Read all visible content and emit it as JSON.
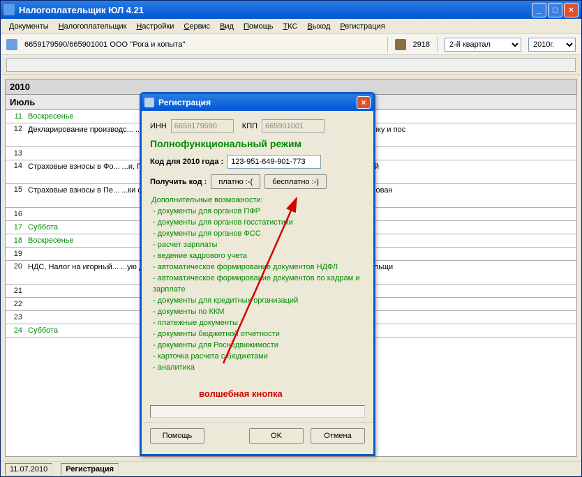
{
  "window": {
    "title": "Налогоплательщик ЮЛ 4.21"
  },
  "menu": {
    "items": [
      {
        "ul": "Д",
        "rest": "окументы"
      },
      {
        "ul": "Н",
        "rest": "алогоплательщик"
      },
      {
        "ul": "Н",
        "rest": "астройки"
      },
      {
        "ul": "С",
        "rest": "ервис"
      },
      {
        "ul": "В",
        "rest": "ид"
      },
      {
        "ul": "П",
        "rest": "омощь"
      },
      {
        "ul": "Т",
        "rest": "КС"
      },
      {
        "ul": "В",
        "rest": "ыход"
      },
      {
        "ul": "Р",
        "rest": "егистрация"
      }
    ]
  },
  "toolbar": {
    "org": "6659179590/665901001 ООО ''Рога и копыта''",
    "code": "2918",
    "quarter": "2-й квартал",
    "year": "2010г."
  },
  "calendar": {
    "year": "2010",
    "month": "Июль",
    "rows": [
      {
        "day": "11",
        "desc": "Воскресенье",
        "green": true
      },
      {
        "day": "12",
        "desc": "Декларирование производс... ...и спиртосодержащей продукции, Организаци производство, закупку и пос",
        "tall": true
      },
      {
        "day": "13",
        "desc": ""
      },
      {
        "day": "14",
        "desc": "Страховые взносы в Фо... ...и, Плательщики страховых взносов на обяза на прибыль организаций",
        "tall": true
      },
      {
        "day": "15",
        "desc": "Страховые взносы в Пе... ...ки страховых взносов на обязательное пенс Фонд социального страхован",
        "tall": true
      },
      {
        "day": "16",
        "desc": ""
      },
      {
        "day": "17",
        "desc": "Суббота",
        "green": true
      },
      {
        "day": "18",
        "desc": "Воскресенье",
        "green": true
      },
      {
        "day": "19",
        "desc": ""
      },
      {
        "day": "20",
        "desc": "НДС, Налог на игорный... ...ую декларацию и, Сбор за пользование объе ресурсов, Налогоплательщи",
        "tall": true
      },
      {
        "day": "21",
        "desc": ""
      },
      {
        "day": "22",
        "desc": ""
      },
      {
        "day": "23",
        "desc": ""
      },
      {
        "day": "24",
        "desc": "Суббота",
        "green": true
      }
    ]
  },
  "statusbar": {
    "date": "11.07.2010",
    "mode": "Регистрация"
  },
  "dialog": {
    "title": "Регистрация",
    "inn_label": "ИНН",
    "inn_value": "6659179590",
    "kpp_label": "КПП",
    "kpp_value": "665901001",
    "mode_title": "Полнофункциональный режим",
    "code_label": "Код для 2010 года :",
    "code_value": "123-951-649-901-773",
    "get_code_label": "Получить код :",
    "pay_btn": "платно  :-(",
    "free_btn": "бесплатно  :-)",
    "features_header": "Дополнительные возможности:",
    "features": [
      "- документы для органов ПФР",
      "- документы для органов госстатистики",
      "- документы для органов ФСС",
      "- расчет зарплаты",
      "- ведение кадрового учета",
      "- автоматическое формирование документов НДФЛ",
      "- автоматическое формирование документов по кадрам и зарплате",
      "- документы для кредитных организаций",
      "- документы по ККМ",
      "- платежные документы",
      "- документы бюджетной отчетности",
      "- документы для Роснедвижимости",
      "- карточка расчета с бюджетами",
      "- аналитика"
    ],
    "magic": "волшебная кнопка",
    "help_btn": "Помощь",
    "ok_btn": "OK",
    "cancel_btn": "Отмена"
  }
}
